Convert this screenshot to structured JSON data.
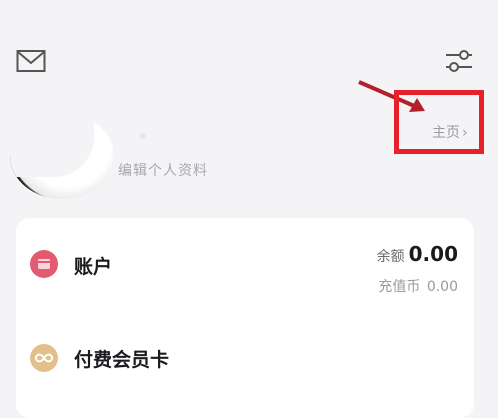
{
  "header": {
    "mail_icon": "mail-icon",
    "filter_icon": "sliders-icon"
  },
  "profile": {
    "edit_label": "编辑个人资料",
    "home_label": "主页",
    "home_chevron": "›"
  },
  "card": {
    "account": {
      "label": "账户",
      "balance_label": "余额",
      "balance_value": "0.00",
      "coin_label": "充值币",
      "coin_value": "0.00",
      "icon_color": "#e35b70"
    },
    "vip": {
      "label": "付费会员卡",
      "icon_color": "#e3c08b"
    }
  },
  "annotation": {
    "highlight_color": "#e8202a"
  }
}
